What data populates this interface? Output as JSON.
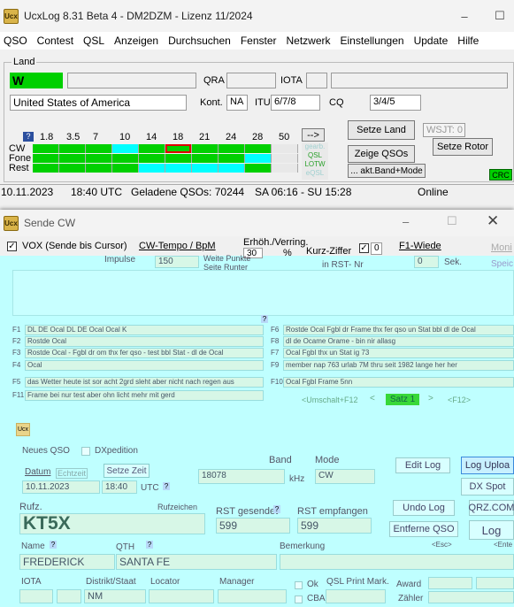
{
  "main": {
    "title": "UcxLog 8.31 Beta 4 - DM2DZM - Lizenz 11/2024",
    "menu": [
      "QSO",
      "Contest",
      "QSL",
      "Anzeigen",
      "Durchsuchen",
      "Fenster",
      "Netzwerk",
      "Einstellungen",
      "Update",
      "Hilfe"
    ],
    "land_group": "Land",
    "prefix": "W",
    "qra_label": "QRA",
    "iota_label": "IOTA",
    "country": "United States of America",
    "kont_label": "Kont.",
    "kont": "NA",
    "itu_label": "ITU",
    "itu": "6/7/8",
    "cq_label": "CQ",
    "cq": "3/4/5",
    "bands": [
      "1.8",
      "3.5",
      "7",
      "10",
      "14",
      "18",
      "21",
      "24",
      "28",
      "50"
    ],
    "modes": [
      "CW",
      "Fone",
      "Rest"
    ],
    "q_label": "?",
    "arrow_btn": "-->",
    "legend": [
      "gearb.",
      "QSL",
      "LOTW",
      "eQSL"
    ],
    "setze_land": "Setze Land",
    "wsjt": "WSJT: 0",
    "zeige_qsos": "Zeige QSOs",
    "setze_rotor": "Setze Rotor",
    "akt_band": "... akt.Band+Mode",
    "crc": "CRC",
    "status": {
      "date": "10.11.2023",
      "time": "18:40 UTC",
      "loaded": "Geladene QSOs: 70244",
      "sun": "SA 06:16 - SU 15:28",
      "online": "Online"
    },
    "colors": {
      "green": "#00d000",
      "cyan": "#00ffff",
      "red": "#e00000"
    }
  },
  "cw": {
    "title": "Sende CW",
    "vox": "VOX (Sende bis Cursor)",
    "tempo_label": "CW-Tempo / BpM",
    "erh_label": "Erhöh./Verring.",
    "kurz_label": "Kurz-Ziffer",
    "f1_label": "F1-Wiede",
    "tempo_val": "150",
    "erh_val": "30",
    "pct": "%",
    "kurz_val": "0",
    "sek_val": "0",
    "sek_label": "Sek.",
    "in_rst": "in RST- Nr",
    "impulse": "Impulse",
    "faded": [
      "Weite Punkte",
      "Seite Runter",
      "Moni",
      "Speic"
    ],
    "macros_left": [
      {
        "k": "F1",
        "t": "DL DE Ocal DL DE Ocal Ocal K"
      },
      {
        "k": "F2",
        "t": "Rostde Ocal"
      },
      {
        "k": "F3",
        "t": "Rostde Ocal - Fgbl dr om thx fer qso - test bbl Stat - dl de Ocal"
      },
      {
        "k": "F4",
        "t": "Ocal"
      },
      {
        "k": "F5",
        "t": "das Wetter heute ist sor acht 2grd sleht aber nicht nach regen aus"
      },
      {
        "k": "F11",
        "t": "Frame bei nur test aber ohn licht mehr mit gerd"
      }
    ],
    "macros_right": [
      {
        "k": "F6",
        "t": "Rostde Ocal Fgbl dr Frame thx fer qso un Stat bbl dl de Ocal"
      },
      {
        "k": "F8",
        "t": "dl de Ocame Orame - bin nir allasg"
      },
      {
        "k": "F7",
        "t": "Ocal Fgbl thx un Stat ig 73"
      },
      {
        "k": "F9",
        "t": "member nap 763 urlab 7M thru seit 1982 lange her her"
      },
      {
        "k": "F10",
        "t": "Ocal Fgbl Frame 5nn"
      }
    ],
    "umschalt": "<Umschalt+F12",
    "satz": "Satz 1",
    "f12": "<F12>",
    "nav_prev": "<",
    "nav_next": ">"
  },
  "log": {
    "neues_qso": "Neues QSO",
    "dxpedition": "DXpedition",
    "datum_label": "Datum",
    "datum_auto": "Echtzeit",
    "setze_zeit": "Setze Zeit",
    "date": "10.11.2023",
    "time": "18:40",
    "utc": "UTC",
    "band_label": "Band",
    "mode_label": "Mode",
    "freq": "18078",
    "khz": "kHz",
    "mode": "CW",
    "rufz_label": "Rufz.",
    "rufz_hint": "Rufzeichen",
    "call": "KT5X",
    "rst_s_label": "RST gesendet",
    "rst_r_label": "RST empfangen",
    "rst_s": "599",
    "rst_r": "599",
    "name_label": "Name",
    "qth_label": "QTH",
    "name": "FREDERICK",
    "qth": "SANTA FE",
    "bemerkung": "Bemerkung",
    "iota_label": "IOTA",
    "dist_label": "Distrikt/Staat",
    "loc_label": "Locator",
    "mgr_label": "Manager",
    "ok": "Ok",
    "cba": "CBA",
    "qsl_print": "QSL Print Mark.",
    "award": "Award",
    "zahler": "Zähler",
    "state": "NM",
    "btns": {
      "edit": "Edit Log",
      "upload": "Log Uploa",
      "dxspot": "DX Spot",
      "undo": "Undo Log",
      "qrz": "QRZ.COM",
      "entferne": "Entferne QSO",
      "log": "Log",
      "esc": "<Esc>",
      "ent": "<Ente"
    },
    "qmark": "?"
  }
}
